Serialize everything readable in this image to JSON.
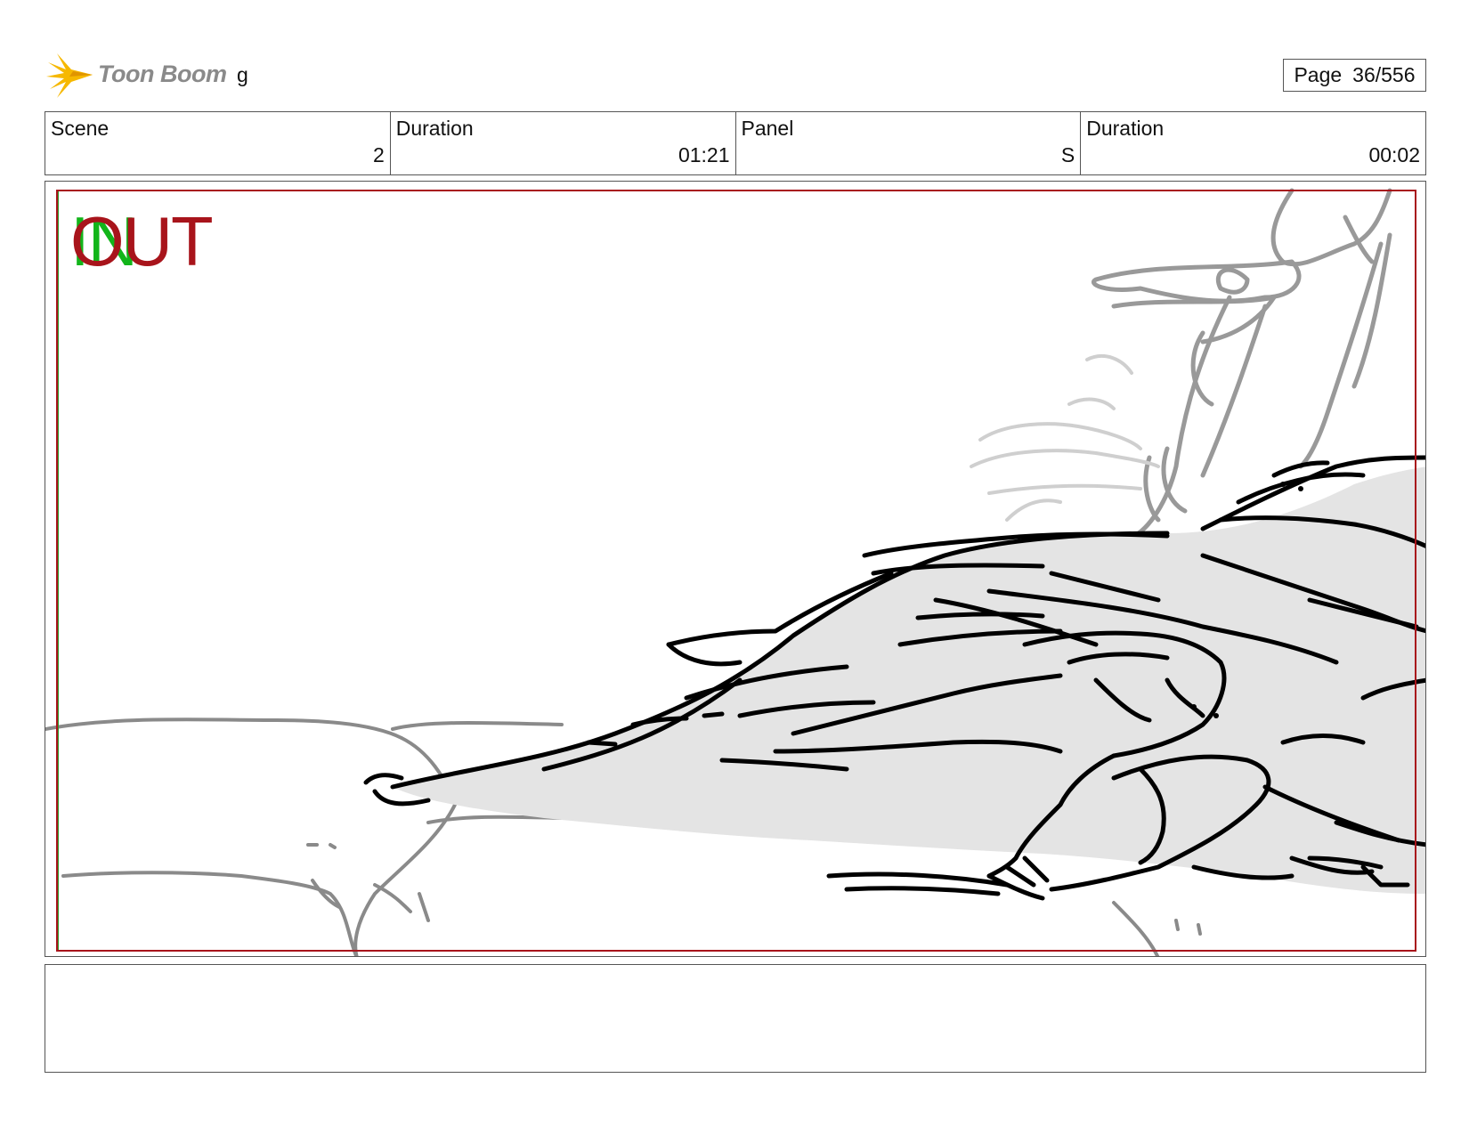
{
  "header": {
    "logo_text": "Toon Boom",
    "project_name": "g",
    "page_label": "Page",
    "page_value": "36/556"
  },
  "info": {
    "scene_label": "Scene",
    "scene_value": "2",
    "scene_duration_label": "Duration",
    "scene_duration_value": "01:21",
    "panel_label": "Panel",
    "panel_value": "S",
    "panel_duration_label": "Duration",
    "panel_duration_value": "00:02"
  },
  "panel": {
    "in_marker": "IN",
    "out_marker": "OUT",
    "frame_color": "#a8141b",
    "in_color": "#12b51a"
  },
  "colors": {
    "logo_yellow": "#f6b800",
    "logo_text": "#8a8a8a",
    "sketch_black": "#000000",
    "sketch_gray": "#888888",
    "sketch_fill": "#e4e4e4"
  }
}
